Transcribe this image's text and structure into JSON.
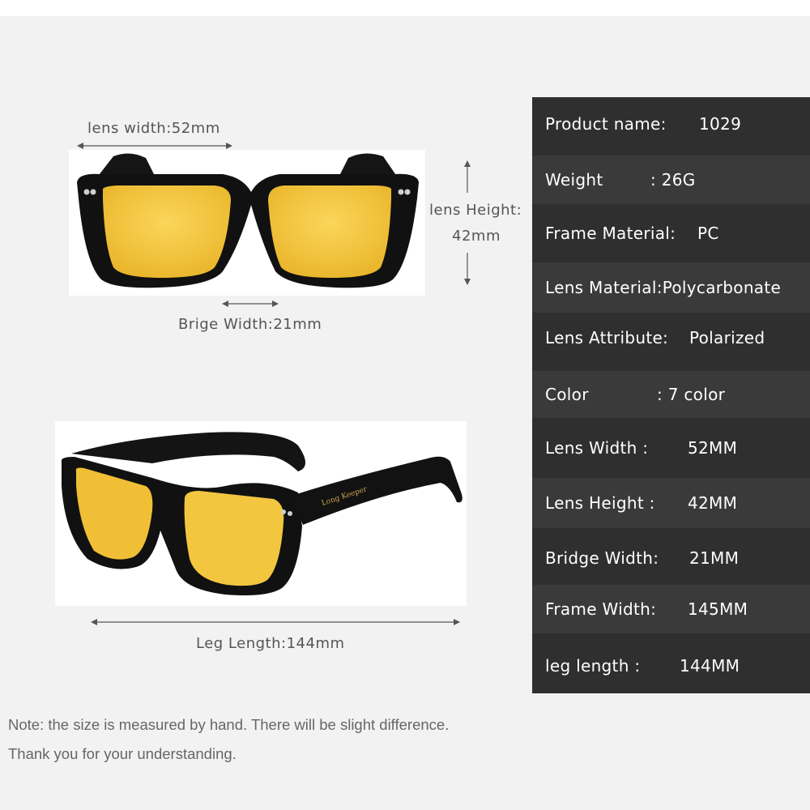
{
  "dimensions": {
    "lens_width": "lens width:52mm",
    "lens_height_line1": "lens Height:",
    "lens_height_line2": "42mm",
    "bridge_width": "Brige Width:21mm",
    "leg_length": "Leg Length:144mm"
  },
  "product_images": {
    "front_view": {
      "lens_color": "#f5c842",
      "frame_color": "#111111"
    },
    "side_view": {
      "lens_color": "#f5c842",
      "frame_color": "#111111",
      "temple_text": "Long Keeper"
    }
  },
  "specs": [
    {
      "key": "Product name:",
      "value": "1029"
    },
    {
      "key": "Weight",
      "value": ": 26G"
    },
    {
      "key": "Frame Material:",
      "value": "PC"
    },
    {
      "key": "Lens Material:",
      "value": "Polycarbonate"
    },
    {
      "key": "Lens Attribute:",
      "value": "Polarized"
    },
    {
      "key": "Color",
      "value": ":    7 color"
    },
    {
      "key": "Lens Width  :",
      "value": "52MM"
    },
    {
      "key": "Lens Height :",
      "value": "42MM"
    },
    {
      "key": "Bridge Width:",
      "value": "21MM"
    },
    {
      "key": "Frame Width:",
      "value": "145MM"
    },
    {
      "key": "leg length   :",
      "value": "144MM"
    }
  ],
  "note": {
    "line1": "Note: the size is measured by hand. There will be slight difference.",
    "line2": "Thank you for your understanding."
  },
  "colors": {
    "panel": "#2f2f2f",
    "panel_alt": "#3a3a3a",
    "lens": "#f5c842"
  }
}
